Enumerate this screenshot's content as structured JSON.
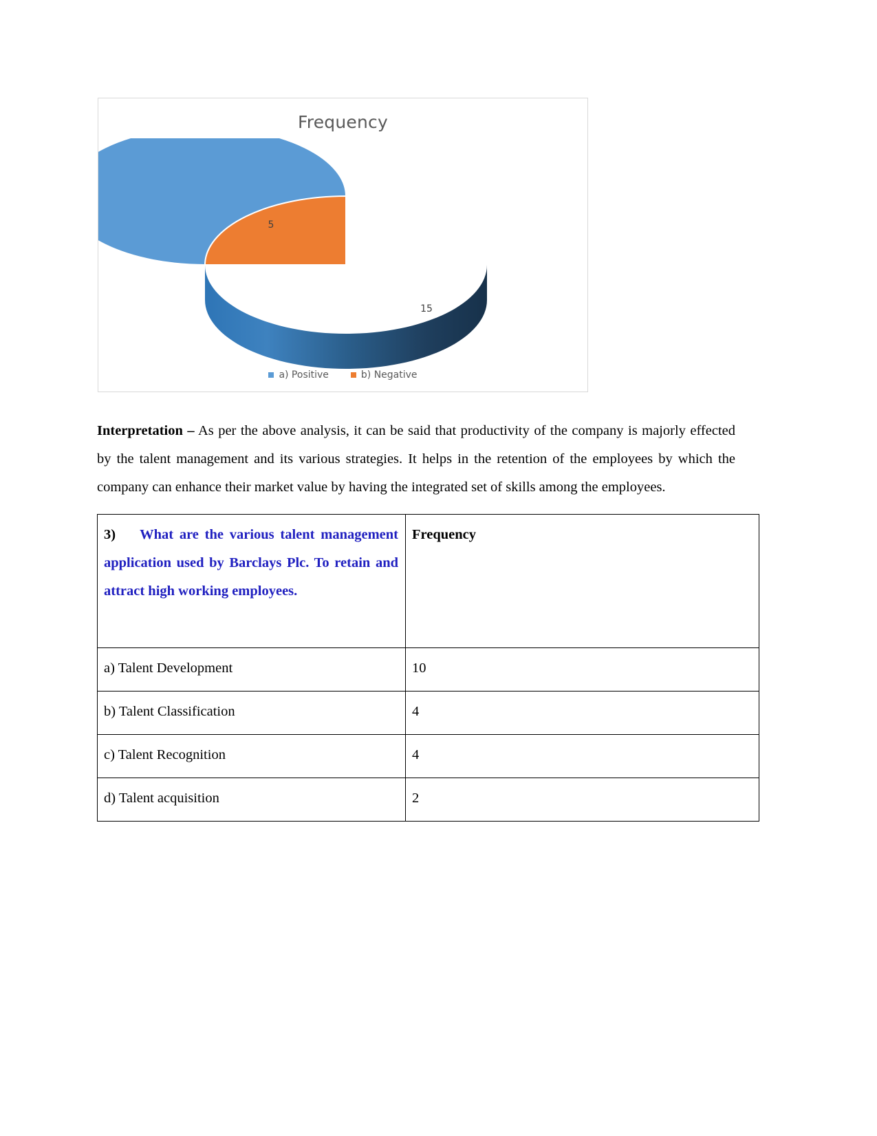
{
  "chart": {
    "title": "Frequency",
    "legend": [
      {
        "label": "a) Positive",
        "color": "#5B9BD5"
      },
      {
        "label": "b) Negative",
        "color": "#ED7D31"
      }
    ],
    "labels": {
      "positive": "15",
      "negative": "5"
    }
  },
  "chart_data": {
    "type": "pie",
    "title": "Frequency",
    "categories": [
      "a) Positive",
      "b) Negative"
    ],
    "values": [
      15,
      5
    ],
    "percentages": [
      75,
      25
    ],
    "colors": [
      "#5B9BD5",
      "#ED7D31"
    ],
    "data_labels": [
      "15",
      "5"
    ],
    "legend_position": "bottom",
    "three_d": true,
    "start_angle": 0,
    "xlabel": "",
    "ylabel": ""
  },
  "interpretation": {
    "heading": "Interpretation –",
    "body": " As per the above analysis, it can be said that productivity of the company is majorly effected by the talent management and its various strategies. It helps in the retention of the employees by which the company can enhance their market value by having the integrated set of skills among the employees."
  },
  "table": {
    "question_number": "3)",
    "question_text": "What are the various talent management application used by Barclays Plc. To retain and attract high working employees.",
    "frequency_header": "Frequency",
    "rows": [
      {
        "option": "a) Talent  Development",
        "frequency": "10"
      },
      {
        "option": "b) Talent Classification",
        "frequency": "4"
      },
      {
        "option": "c) Talent  Recognition",
        "frequency": "4"
      },
      {
        "option": "d) Talent acquisition",
        "frequency": "2"
      }
    ]
  }
}
